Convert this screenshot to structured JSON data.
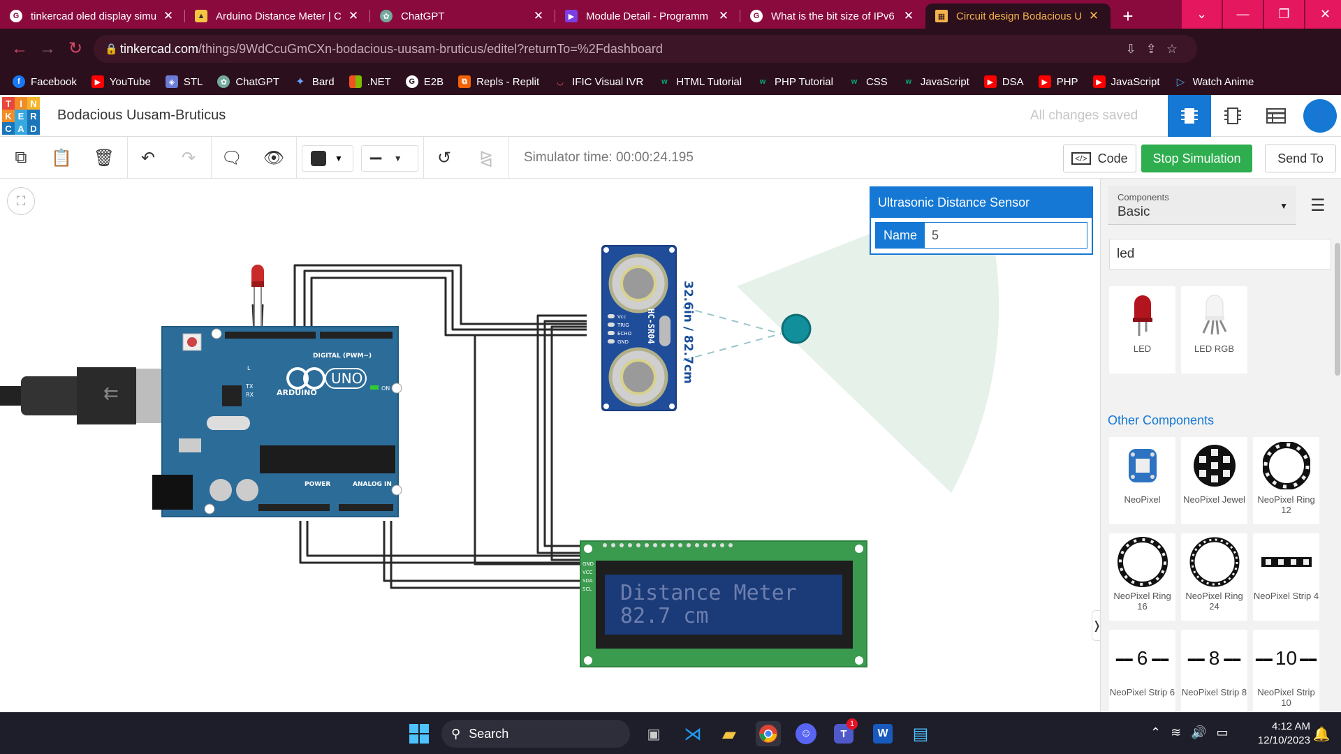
{
  "browser": {
    "tabs": [
      {
        "title": "tinkercad oled display simu",
        "icon": "google-icon",
        "color": "#ffffff"
      },
      {
        "title": "Arduino Distance Meter | C",
        "icon": "instructables-icon",
        "color": "#f5c542"
      },
      {
        "title": "ChatGPT",
        "icon": "chatgpt-icon",
        "color": "#74aa9c"
      },
      {
        "title": "Module Detail - Programm",
        "icon": "module-icon",
        "color": "#7b3fe4"
      },
      {
        "title": "What is the bit size of IPv6",
        "icon": "google-icon",
        "color": "#ffffff"
      },
      {
        "title": "Circuit design Bodacious U",
        "icon": "tinkercad-icon",
        "color": "#f3b24b"
      }
    ],
    "url_host": "tinkercad.com",
    "url_path": "/things/9WdCcuGmCXn-bodacious-uusam-bruticus/editel?returnTo=%2Fdashboard"
  },
  "bookmarks": [
    {
      "label": "Facebook",
      "icon": "facebook-icon",
      "color": "#1877f2"
    },
    {
      "label": "YouTube",
      "icon": "youtube-icon",
      "color": "#ff0000"
    },
    {
      "label": "STL",
      "icon": "stl-icon",
      "color": "#6b7bd6"
    },
    {
      "label": "ChatGPT",
      "icon": "chatgpt-icon",
      "color": "#74aa9c"
    },
    {
      "label": "Bard",
      "icon": "bard-icon",
      "color": "#4a8af4"
    },
    {
      "label": ".NET",
      "icon": "windows-icon",
      "color": "#f25022"
    },
    {
      "label": "E2B",
      "icon": "google-icon",
      "color": "#ffffff"
    },
    {
      "label": "Repls - Replit",
      "icon": "replit-icon",
      "color": "#f26207"
    },
    {
      "label": "IFIC Visual IVR",
      "icon": "ific-icon",
      "color": "#d33"
    },
    {
      "label": "HTML Tutorial",
      "icon": "w3schools-icon",
      "color": "#04aa6d"
    },
    {
      "label": "PHP Tutorial",
      "icon": "w3schools-icon",
      "color": "#04aa6d"
    },
    {
      "label": "CSS",
      "icon": "w3schools-icon",
      "color": "#04aa6d"
    },
    {
      "label": "JavaScript",
      "icon": "w3schools-icon",
      "color": "#04aa6d"
    },
    {
      "label": "DSA",
      "icon": "youtube-icon",
      "color": "#ff0000"
    },
    {
      "label": "PHP",
      "icon": "youtube-icon",
      "color": "#ff0000"
    },
    {
      "label": "JavaScript",
      "icon": "youtube-icon",
      "color": "#ff0000"
    },
    {
      "label": "Watch Anime",
      "icon": "play-icon",
      "color": "#4aa3df"
    }
  ],
  "header": {
    "logo_letters": [
      "T",
      "I",
      "N",
      "K",
      "E",
      "R",
      "C",
      "A",
      "D"
    ],
    "design_title": "Bodacious Uusam-Bruticus",
    "save_status": "All changes saved"
  },
  "toolbar": {
    "sim_time": "Simulator time: 00:00:24.195",
    "code_label": "Code",
    "stop_label": "Stop Simulation",
    "send_label": "Send To"
  },
  "inspector": {
    "title": "Ultrasonic Distance Sensor",
    "name_label": "Name",
    "name_value": "5"
  },
  "circuit": {
    "sensor_model": "HC-SR04",
    "sensor_pins": [
      "Vcc",
      "TRIG",
      "ECHO",
      "GND"
    ],
    "distance_readout": "32.6in / 82.7cm",
    "lcd_line1": "Distance Meter",
    "lcd_line2": "82.7 cm",
    "lcd_pins": [
      "GND",
      "VCC",
      "SDA",
      "SCL"
    ],
    "arduino_brand": "ARDUINO",
    "arduino_model": "UNO",
    "arduino_labels": {
      "digital": "DIGITAL (PWM~)",
      "power": "POWER",
      "analog": "ANALOG IN",
      "on": "ON",
      "tx": "TX",
      "rx": "RX",
      "l": "L"
    }
  },
  "panel": {
    "components_label": "Components",
    "components_value": "Basic",
    "search_value": "led",
    "results": [
      {
        "label": "LED"
      },
      {
        "label": "LED RGB"
      }
    ],
    "other_heading": "Other Components",
    "others": [
      {
        "label": "NeoPixel"
      },
      {
        "label": "NeoPixel Jewel"
      },
      {
        "label": "NeoPixel Ring 12"
      },
      {
        "label": "NeoPixel Ring 16"
      },
      {
        "label": "NeoPixel Ring 24"
      },
      {
        "label": "NeoPixel Strip 4"
      },
      {
        "label": "NeoPixel Strip 6",
        "count": "6"
      },
      {
        "label": "NeoPixel Strip 8",
        "count": "8"
      },
      {
        "label": "NeoPixel Strip 10",
        "count": "10"
      }
    ]
  },
  "taskbar": {
    "search_label": "Search",
    "time": "4:12 AM",
    "date": "12/10/2023",
    "teams_badge": "1"
  }
}
